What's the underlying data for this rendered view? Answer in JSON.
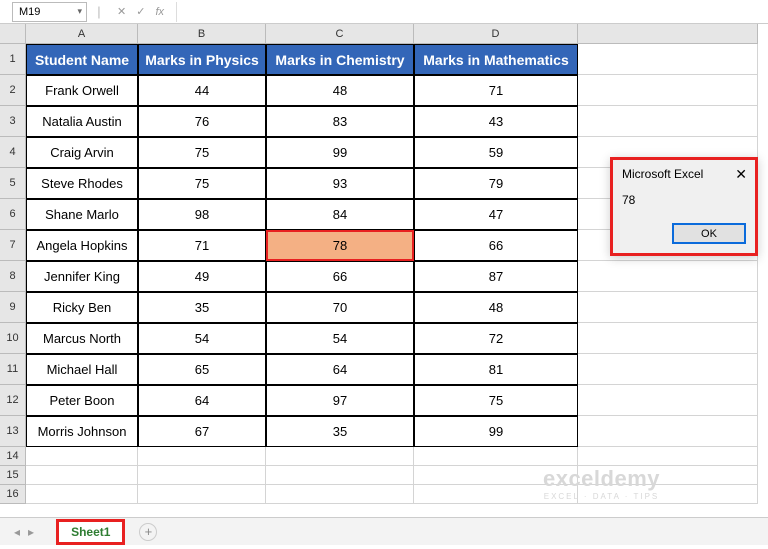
{
  "app": {
    "name_box": "M19"
  },
  "columns": [
    "A",
    "B",
    "C",
    "D"
  ],
  "rows": [
    "1",
    "2",
    "3",
    "4",
    "5",
    "6",
    "7",
    "8",
    "9",
    "10",
    "11",
    "12",
    "13",
    "14",
    "15",
    "16"
  ],
  "headers": {
    "a": "Student Name",
    "b": "Marks in Physics",
    "c": "Marks in Chemistry",
    "d": "Marks in Mathematics"
  },
  "data": [
    {
      "name": "Frank Orwell",
      "p": "44",
      "c": "48",
      "m": "71"
    },
    {
      "name": "Natalia Austin",
      "p": "76",
      "c": "83",
      "m": "43"
    },
    {
      "name": "Craig Arvin",
      "p": "75",
      "c": "99",
      "m": "59"
    },
    {
      "name": "Steve Rhodes",
      "p": "75",
      "c": "93",
      "m": "79"
    },
    {
      "name": "Shane Marlo",
      "p": "98",
      "c": "84",
      "m": "47"
    },
    {
      "name": "Angela Hopkins",
      "p": "71",
      "c": "78",
      "m": "66"
    },
    {
      "name": "Jennifer King",
      "p": "49",
      "c": "66",
      "m": "87"
    },
    {
      "name": "Ricky Ben",
      "p": "35",
      "c": "70",
      "m": "48"
    },
    {
      "name": "Marcus North",
      "p": "54",
      "c": "54",
      "m": "72"
    },
    {
      "name": "Michael Hall",
      "p": "65",
      "c": "64",
      "m": "81"
    },
    {
      "name": "Peter Boon",
      "p": "64",
      "c": "97",
      "m": "75"
    },
    {
      "name": "Morris Johnson",
      "p": "67",
      "c": "35",
      "m": "99"
    }
  ],
  "msgbox": {
    "title": "Microsoft Excel",
    "value": "78",
    "ok": "OK",
    "close": "✕"
  },
  "tabs": {
    "active": "Sheet1"
  },
  "watermark": {
    "main": "exceldemy",
    "sub": "EXCEL · DATA · TIPS"
  }
}
